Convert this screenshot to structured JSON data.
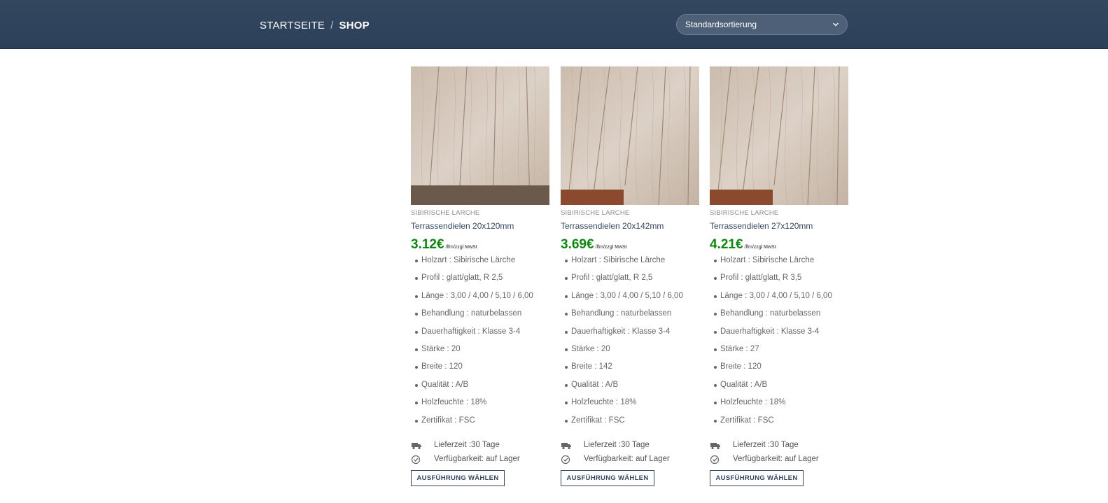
{
  "breadcrumb": {
    "home": "STARTSEITE",
    "separator": "/",
    "current": "SHOP"
  },
  "sort": {
    "selected": "Standardsortierung",
    "icon": "chevron-down-icon"
  },
  "colors": {
    "header_bg": "#2d405a",
    "price_green": "#0a8a0a",
    "link_blue": "#334862"
  },
  "products": [
    {
      "category": "SIBIRISCHE LARCHE",
      "title": "Terrassendielen 20x120mm",
      "price": "3.12€",
      "unit": "/lfm/zzgl MwSt",
      "specs": [
        "Holzart : Sibirische Lärche",
        "Profil : glatt/glatt, R 2,5",
        "Länge : 3,00 / 4,00 / 5,10 / 6,00",
        "Behandlung : naturbelassen",
        "Dauerhaftigkeit : Klasse 3-4",
        "Stärke : 20",
        "Breite : 120",
        "Qualität : A/B",
        "Holzfeuchte : 18%",
        "Zertifikat : FSC"
      ],
      "delivery": "Lieferzeit :30 Tage",
      "availability": "Verfügbarkeit: auf Lager",
      "button": "AUSFÜHRUNG WÄHLEN"
    },
    {
      "category": "SIBIRISCHE LARCHE",
      "title": "Terrassendielen 20x142mm",
      "price": "3.69€",
      "unit": "/lfm/zzgl MwSt",
      "specs": [
        "Holzart : Sibirische Lärche",
        "Profil : glatt/glatt, R 2,5",
        "Länge : 3,00 / 4,00 / 5,10 / 6,00",
        "Behandlung : naturbelassen",
        "Dauerhaftigkeit : Klasse 3-4",
        "Stärke : 20",
        "Breite : 142",
        "Qualität : A/B",
        "Holzfeuchte : 18%",
        "Zertifikat : FSC"
      ],
      "delivery": "Lieferzeit :30 Tage",
      "availability": "Verfügbarkeit: auf Lager",
      "button": "AUSFÜHRUNG WÄHLEN"
    },
    {
      "category": "SIBIRISCHE LARCHE",
      "title": "Terrassendielen 27x120mm",
      "price": "4.21€",
      "unit": "/lfm/zzgl MwSt",
      "specs": [
        "Holzart : Sibirische Lärche",
        "Profil : glatt/glatt, R 3,5",
        "Länge : 3,00 / 4,00 / 5,10 / 6,00",
        "Behandlung : naturbelassen",
        "Dauerhaftigkeit : Klasse 3-4",
        "Stärke : 27",
        "Breite : 120",
        "Qualität : A/B",
        "Holzfeuchte : 18%",
        "Zertifikat : FSC"
      ],
      "delivery": "Lieferzeit :30 Tage",
      "availability": "Verfügbarkeit: auf Lager",
      "button": "AUSFÜHRUNG WÄHLEN"
    }
  ]
}
